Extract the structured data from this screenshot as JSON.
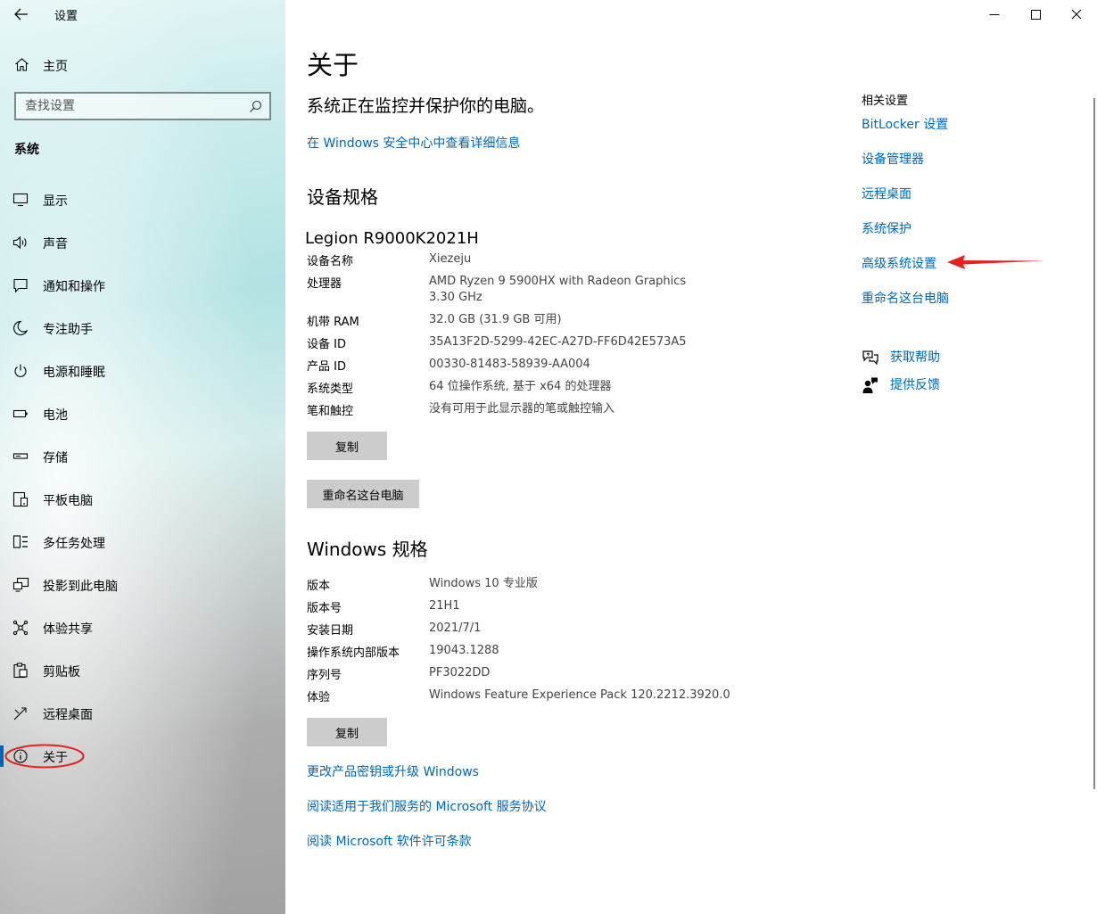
{
  "window": {
    "app_title": "设置"
  },
  "sidebar": {
    "home_label": "主页",
    "search_placeholder": "查找设置",
    "section_title": "系统",
    "items": [
      {
        "label": "显示",
        "icon": "display-icon"
      },
      {
        "label": "声音",
        "icon": "sound-icon"
      },
      {
        "label": "通知和操作",
        "icon": "notification-icon"
      },
      {
        "label": "专注助手",
        "icon": "moon-icon"
      },
      {
        "label": "电源和睡眠",
        "icon": "power-icon"
      },
      {
        "label": "电池",
        "icon": "battery-icon"
      },
      {
        "label": "存储",
        "icon": "storage-icon"
      },
      {
        "label": "平板电脑",
        "icon": "tablet-icon"
      },
      {
        "label": "多任务处理",
        "icon": "multitask-icon"
      },
      {
        "label": "投影到此电脑",
        "icon": "project-icon"
      },
      {
        "label": "体验共享",
        "icon": "share-icon"
      },
      {
        "label": "剪贴板",
        "icon": "clipboard-icon"
      },
      {
        "label": "远程桌面",
        "icon": "remote-desktop-icon"
      },
      {
        "label": "关于",
        "icon": "info-icon"
      }
    ],
    "selected": "关于"
  },
  "main": {
    "title": "关于",
    "protection_text": "系统正在监控并保护你的电脑。",
    "security_link": "在 Windows 安全中心中查看详细信息",
    "device_specs": {
      "heading": "设备规格",
      "device_model": "Legion R9000K2021H",
      "rows": [
        {
          "key": "设备名称",
          "value": "Xiezeju"
        },
        {
          "key": "处理器",
          "value": "AMD Ryzen 9 5900HX with Radeon Graphics",
          "value2": "3.30 GHz"
        },
        {
          "key": "机带 RAM",
          "value": "32.0 GB (31.9 GB 可用)"
        },
        {
          "key": "设备 ID",
          "value": "35A13F2D-5299-42EC-A27D-FF6D42E573A5"
        },
        {
          "key": "产品 ID",
          "value": "00330-81483-58939-AA004"
        },
        {
          "key": "系统类型",
          "value": "64 位操作系统, 基于 x64 的处理器"
        },
        {
          "key": "笔和触控",
          "value": "没有可用于此显示器的笔或触控输入"
        }
      ],
      "copy_label": "复制",
      "rename_label": "重命名这台电脑"
    },
    "windows_specs": {
      "heading": "Windows 规格",
      "rows": [
        {
          "key": "版本",
          "value": "Windows 10 专业版"
        },
        {
          "key": "版本号",
          "value": "21H1"
        },
        {
          "key": "安装日期",
          "value": "2021/7/1"
        },
        {
          "key": "操作系统内部版本",
          "value": "19043.1288"
        },
        {
          "key": "序列号",
          "value": "PF3022DD"
        },
        {
          "key": "体验",
          "value": "Windows Feature Experience Pack 120.2212.3920.0"
        }
      ],
      "copy_label": "复制"
    },
    "bottom_links": [
      "更改产品密钥或升级 Windows",
      "阅读适用于我们服务的 Microsoft 服务协议",
      "阅读 Microsoft 软件许可条款"
    ]
  },
  "related": {
    "title": "相关设置",
    "links": [
      "BitLocker 设置",
      "设备管理器",
      "远程桌面",
      "系统保护",
      "高级系统设置",
      "重命名这台电脑"
    ],
    "help_label": "获取帮助",
    "feedback_label": "提供反馈"
  },
  "colors": {
    "link": "#0067b8",
    "accent": "#0063b1",
    "annotation_red": "#e8201c",
    "button_bg": "#cccccc"
  }
}
